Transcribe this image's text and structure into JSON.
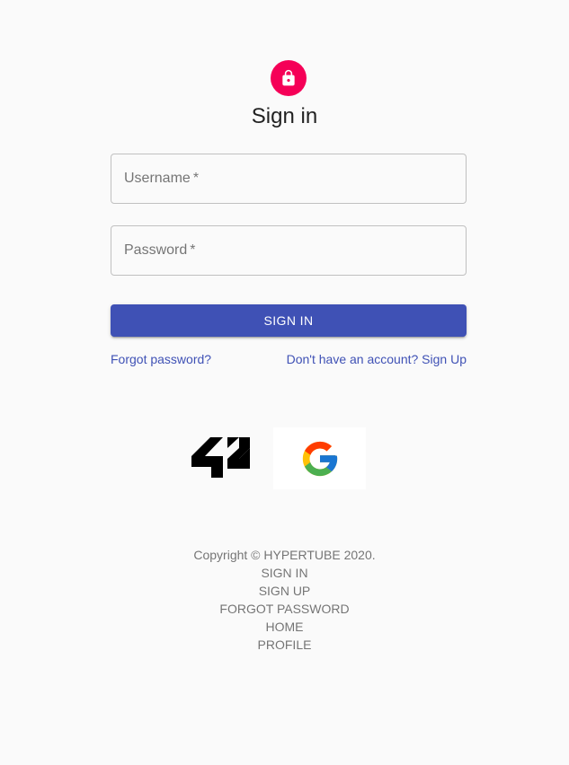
{
  "header": {
    "icon": "lock-icon",
    "title": "Sign in",
    "accent_color": "#f50057"
  },
  "form": {
    "username": {
      "label": "Username",
      "required_mark": "*",
      "value": ""
    },
    "password": {
      "label": "Password",
      "required_mark": "*",
      "value": ""
    },
    "submit_label": "SIGN IN",
    "primary_color": "#3f51b5"
  },
  "links": {
    "forgot": "Forgot password?",
    "signup": "Don't have an account? Sign Up"
  },
  "oauth": {
    "providers": [
      {
        "name": "42",
        "icon": "42-logo-icon"
      },
      {
        "name": "Google",
        "icon": "google-logo-icon"
      }
    ]
  },
  "footer": {
    "copyright": "Copyright © HYPERTUBE 2020.",
    "links": [
      "SIGN IN",
      "SIGN UP",
      "FORGOT PASSWORD",
      "HOME",
      "PROFILE"
    ]
  }
}
